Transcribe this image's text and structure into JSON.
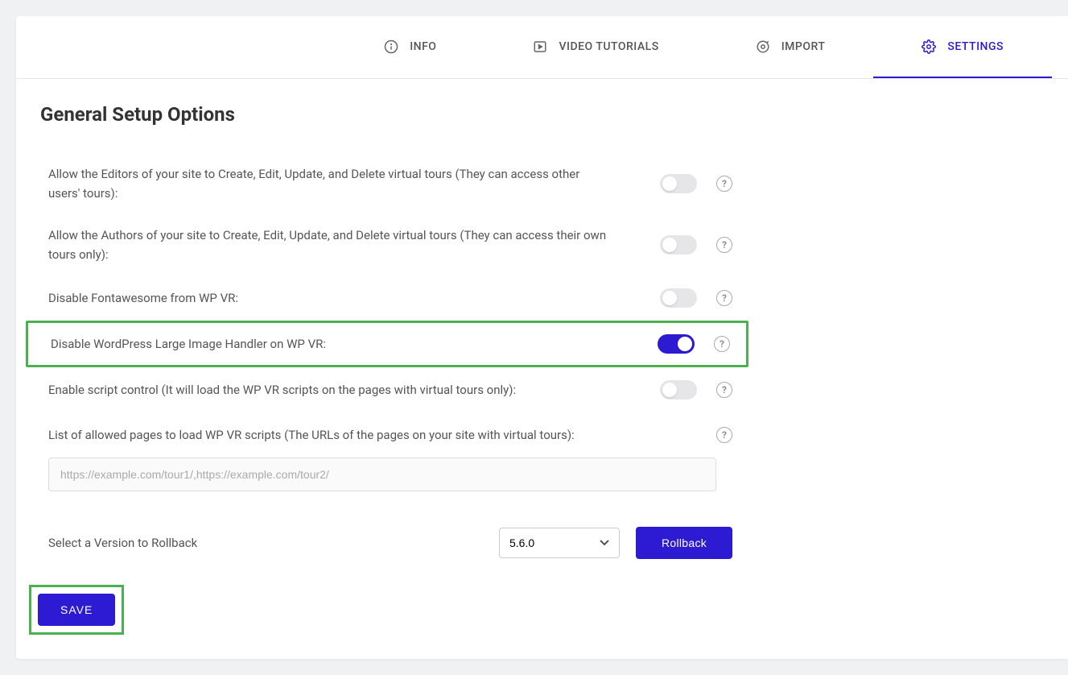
{
  "tabs": {
    "info": "INFO",
    "video": "VIDEO TUTORIALS",
    "import": "IMPORT",
    "settings": "SETTINGS"
  },
  "heading": "General Setup Options",
  "options": {
    "editors": "Allow the Editors of your site to Create, Edit, Update, and Delete virtual tours (They can access other users' tours):",
    "authors": "Allow the Authors of your site to Create, Edit, Update, and Delete virtual tours (They can access their own tours only):",
    "fontawesome": "Disable Fontawesome from WP VR:",
    "large_image": "Disable WordPress Large Image Handler on WP VR:",
    "script_control": "Enable script control (It will load the WP VR scripts on the pages with virtual tours only):",
    "allowed_pages": "List of allowed pages to load WP VR scripts (The URLs of the pages on your site with virtual tours):"
  },
  "input": {
    "placeholder": "https://example.com/tour1/,https://example.com/tour2/"
  },
  "rollback": {
    "label": "Select a Version to Rollback",
    "selected": "5.6.0",
    "button": "Rollback"
  },
  "save_label": "SAVE",
  "help_glyph": "?"
}
